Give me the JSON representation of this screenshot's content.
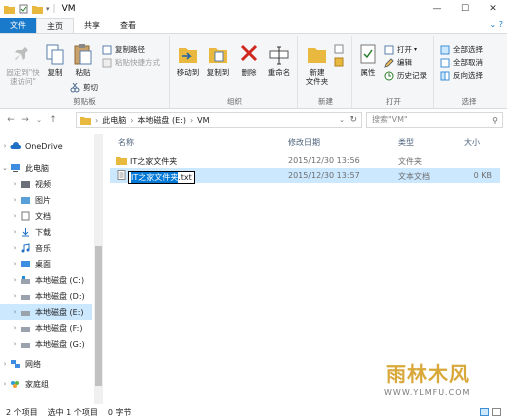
{
  "window": {
    "title": "VM"
  },
  "ribbon_tabs": [
    {
      "label": "文件"
    },
    {
      "label": "主页"
    },
    {
      "label": "共享"
    },
    {
      "label": "查看"
    }
  ],
  "ribbon": {
    "clipboard": {
      "label": "剪贴板",
      "pin_label": "固定到\"快速访问\"",
      "copy_label": "复制",
      "paste_label": "粘贴",
      "copy_path_label": "复制路径",
      "paste_shortcut_label": "粘贴快捷方式",
      "cut_label": "剪切"
    },
    "organize": {
      "label": "组织",
      "move_to_label": "移动到",
      "copy_to_label": "复制到",
      "delete_label": "删除",
      "rename_label": "重命名"
    },
    "new": {
      "label": "新建",
      "new_folder_label": "新建\n文件夹"
    },
    "open": {
      "label": "打开",
      "properties_label": "属性",
      "open_label": "打开",
      "edit_label": "编辑",
      "history_label": "历史记录"
    },
    "select": {
      "label": "选择",
      "select_all_label": "全部选择",
      "select_none_label": "全部取消",
      "invert_label": "反向选择"
    }
  },
  "address": {
    "segments": [
      "此电脑",
      "本地磁盘 (E:)",
      "VM"
    ],
    "search_placeholder": "搜索\"VM\""
  },
  "nav": {
    "items": [
      {
        "label": "OneDrive"
      },
      {
        "label": "此电脑"
      },
      {
        "label": "视频"
      },
      {
        "label": "图片"
      },
      {
        "label": "文档"
      },
      {
        "label": "下载"
      },
      {
        "label": "音乐"
      },
      {
        "label": "桌面"
      },
      {
        "label": "本地磁盘 (C:)"
      },
      {
        "label": "本地磁盘 (D:)"
      },
      {
        "label": "本地磁盘 (E:)"
      },
      {
        "label": "本地磁盘 (F:)"
      },
      {
        "label": "本地磁盘 (G:)"
      },
      {
        "label": "网络"
      },
      {
        "label": "家庭组"
      }
    ]
  },
  "columns": {
    "name": "名称",
    "date": "修改日期",
    "type": "类型",
    "size": "大小"
  },
  "files": [
    {
      "name": "IT之家文件夹",
      "date": "2015/12/30 13:56",
      "type": "文件夹",
      "size": ""
    },
    {
      "name_selected": "IT之家文件夹",
      "name_ext": ".txt",
      "date": "2015/12/30 13:57",
      "type": "文本文档",
      "size": "0 KB"
    }
  ],
  "status": {
    "count": "2 个项目",
    "selected": "选中 1 个项目",
    "size": "0 字节"
  },
  "watermark": {
    "text": "雨林木风",
    "url": "WWW.YLMFU.COM"
  },
  "colors": {
    "accent": "#1979ca",
    "selection": "#cce8ff"
  }
}
